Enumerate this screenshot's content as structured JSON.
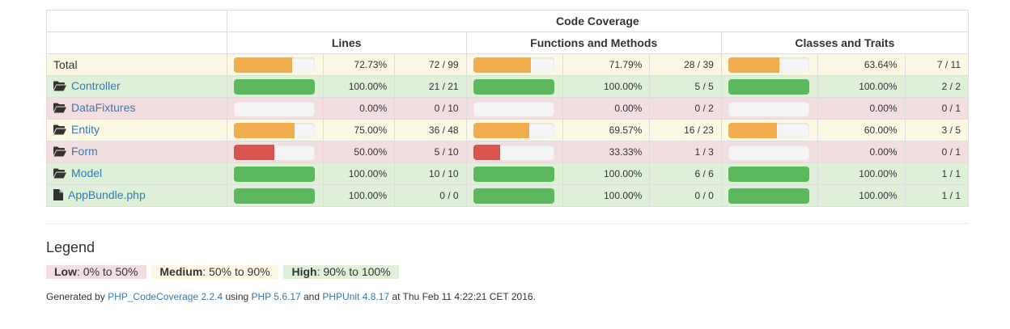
{
  "header": {
    "title": "Code Coverage",
    "col_lines": "Lines",
    "col_functions": "Functions and Methods",
    "col_classes": "Classes and Traits"
  },
  "colors": {
    "success_bg": "#dff0d8",
    "warning_bg": "#fcf8e3",
    "danger_bg": "#f2dede",
    "bar_success": "#5cb85c",
    "bar_warning": "#f0ad4e",
    "bar_danger": "#d9534f"
  },
  "rows": [
    {
      "name": "Total",
      "icon": "",
      "link": false,
      "level": "warning",
      "lines": {
        "pct": "72.73%",
        "ratio": "72 / 99",
        "fill": 72.73,
        "level": "warning"
      },
      "functions": {
        "pct": "71.79%",
        "ratio": "28 / 39",
        "fill": 71.79,
        "level": "warning"
      },
      "classes": {
        "pct": "63.64%",
        "ratio": "7 / 11",
        "fill": 63.64,
        "level": "warning"
      }
    },
    {
      "name": "Controller",
      "icon": "folder-open-icon",
      "link": true,
      "level": "success",
      "lines": {
        "pct": "100.00%",
        "ratio": "21 / 21",
        "fill": 100,
        "level": "success"
      },
      "functions": {
        "pct": "100.00%",
        "ratio": "5 / 5",
        "fill": 100,
        "level": "success"
      },
      "classes": {
        "pct": "100.00%",
        "ratio": "2 / 2",
        "fill": 100,
        "level": "success"
      }
    },
    {
      "name": "DataFixtures",
      "icon": "folder-open-icon",
      "link": true,
      "level": "danger",
      "lines": {
        "pct": "0.00%",
        "ratio": "0 / 10",
        "fill": 0,
        "level": "danger"
      },
      "functions": {
        "pct": "0.00%",
        "ratio": "0 / 2",
        "fill": 0,
        "level": "danger"
      },
      "classes": {
        "pct": "0.00%",
        "ratio": "0 / 1",
        "fill": 0,
        "level": "danger"
      }
    },
    {
      "name": "Entity",
      "icon": "folder-open-icon",
      "link": true,
      "level": "warning",
      "lines": {
        "pct": "75.00%",
        "ratio": "36 / 48",
        "fill": 75,
        "level": "warning"
      },
      "functions": {
        "pct": "69.57%",
        "ratio": "16 / 23",
        "fill": 69.57,
        "level": "warning"
      },
      "classes": {
        "pct": "60.00%",
        "ratio": "3 / 5",
        "fill": 60,
        "level": "warning"
      }
    },
    {
      "name": "Form",
      "icon": "folder-open-icon",
      "link": true,
      "level": "danger",
      "lines": {
        "pct": "50.00%",
        "ratio": "5 / 10",
        "fill": 50,
        "level": "danger"
      },
      "functions": {
        "pct": "33.33%",
        "ratio": "1 / 3",
        "fill": 33.33,
        "level": "danger"
      },
      "classes": {
        "pct": "0.00%",
        "ratio": "0 / 1",
        "fill": 0,
        "level": "danger"
      }
    },
    {
      "name": "Model",
      "icon": "folder-open-icon",
      "link": true,
      "level": "success",
      "lines": {
        "pct": "100.00%",
        "ratio": "10 / 10",
        "fill": 100,
        "level": "success"
      },
      "functions": {
        "pct": "100.00%",
        "ratio": "6 / 6",
        "fill": 100,
        "level": "success"
      },
      "classes": {
        "pct": "100.00%",
        "ratio": "1 / 1",
        "fill": 100,
        "level": "success"
      }
    },
    {
      "name": "AppBundle.php",
      "icon": "file-icon",
      "link": true,
      "level": "success",
      "lines": {
        "pct": "100.00%",
        "ratio": "0 / 0",
        "fill": 100,
        "level": "success"
      },
      "functions": {
        "pct": "100.00%",
        "ratio": "0 / 0",
        "fill": 100,
        "level": "success"
      },
      "classes": {
        "pct": "100.00%",
        "ratio": "1 / 1",
        "fill": 100,
        "level": "success"
      }
    }
  ],
  "legend": {
    "title": "Legend",
    "low_label": "Low",
    "low_range": ": 0% to 50%",
    "medium_label": "Medium",
    "medium_range": ": 50% to 90%",
    "high_label": "High",
    "high_range": ": 90% to 100%"
  },
  "footer": {
    "generated_by": "Generated by ",
    "tool_link": "PHP_CodeCoverage 2.2.4",
    "using": " using ",
    "php_link": "PHP 5.6.17",
    "and": " and ",
    "phpunit_link": "PHPUnit 4.8.17",
    "at": " at Thu Feb 11 4:22:21 CET 2016."
  }
}
